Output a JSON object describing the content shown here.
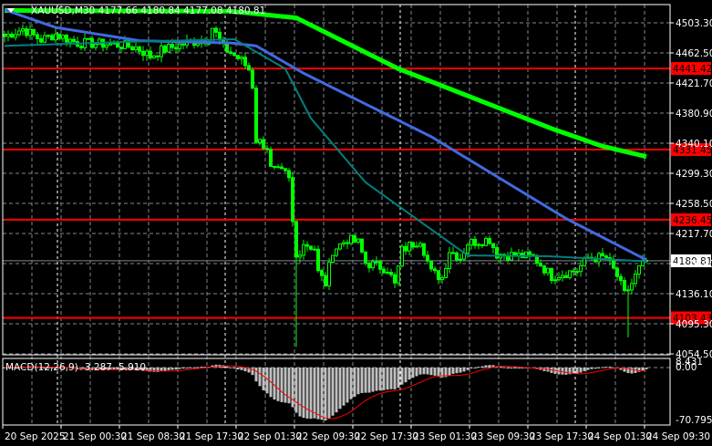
{
  "header": {
    "text": "XAUUSD,M30  4177.66 4180.84 4177.08 4180.81"
  },
  "price_axis": {
    "labels": [
      "4503.30",
      "4462.50",
      "4421.70",
      "4380.90",
      "4340.10",
      "4299.30",
      "4258.50",
      "4217.70",
      "4176.90",
      "4136.10",
      "4095.30",
      "4054.50"
    ]
  },
  "levels": [
    {
      "label": "4441.42",
      "price": 4441.42
    },
    {
      "label": "4331.45",
      "price": 4331.45
    },
    {
      "label": "4236.45",
      "price": 4236.45
    },
    {
      "label": "4103.43",
      "price": 4103.43
    }
  ],
  "current_price": {
    "label": "4180.81",
    "price": 4180.81
  },
  "time_axis": {
    "labels": [
      "20 Sep 2025",
      "21 Sep 00:30",
      "21 Sep 08:30",
      "21 Sep 17:30",
      "22 Sep 01:30",
      "22 Sep 09:30",
      "22 Sep 17:30",
      "23 Sep 01:30",
      "23 Sep 09:30",
      "23 Sep 17:30",
      "24 Sep 01:30",
      "24 Sep 09:30"
    ]
  },
  "macd": {
    "label": "MACD(12,26,9) -3.287 -5.910",
    "axis_labels": [
      "8.431",
      "0.00",
      "-70.795"
    ],
    "max": 8.431,
    "min": -70.795
  },
  "colors": {
    "candle": "#00ff00",
    "ma_slow": "#00ff00",
    "ma_mid": "#4169e1",
    "ma_fast": "#008080",
    "level": "#ff0000",
    "macd_hist": "#c0c0c0",
    "macd_signal": "#ff0000"
  },
  "chart_data": {
    "type": "candlestick",
    "symbol": "XAUUSD",
    "timeframe": "M30",
    "bars": 177,
    "ylim": [
      4054.5,
      4520
    ],
    "close_keypoints": [
      [
        0,
        4485
      ],
      [
        5,
        4495
      ],
      [
        10,
        4480
      ],
      [
        14,
        4488
      ],
      [
        20,
        4476
      ],
      [
        30,
        4474
      ],
      [
        36,
        4470
      ],
      [
        40,
        4458
      ],
      [
        43,
        4466
      ],
      [
        50,
        4476
      ],
      [
        56,
        4482
      ],
      [
        57,
        4497
      ],
      [
        60,
        4470
      ],
      [
        65,
        4452
      ],
      [
        67,
        4440
      ],
      [
        68,
        4418
      ],
      [
        69,
        4345
      ],
      [
        72,
        4335
      ],
      [
        73,
        4305
      ],
      [
        77,
        4298
      ],
      [
        78,
        4290
      ],
      [
        79,
        4232
      ],
      [
        80,
        4185
      ],
      [
        82,
        4205
      ],
      [
        85,
        4198
      ],
      [
        86,
        4165
      ],
      [
        88,
        4150
      ],
      [
        90,
        4195
      ],
      [
        94,
        4210
      ],
      [
        97,
        4205
      ],
      [
        99,
        4178
      ],
      [
        105,
        4170
      ],
      [
        107,
        4148
      ],
      [
        109,
        4195
      ],
      [
        114,
        4210
      ],
      [
        117,
        4165
      ],
      [
        120,
        4158
      ],
      [
        122,
        4195
      ],
      [
        125,
        4185
      ],
      [
        127,
        4205
      ],
      [
        133,
        4210
      ],
      [
        135,
        4190
      ],
      [
        145,
        4186
      ],
      [
        150,
        4160
      ],
      [
        157,
        4168
      ],
      [
        160,
        4185
      ],
      [
        165,
        4185
      ],
      [
        168,
        4160
      ],
      [
        170,
        4135
      ],
      [
        172,
        4150
      ],
      [
        174,
        4170
      ],
      [
        176,
        4181
      ]
    ],
    "wick_lows": [
      [
        80,
        4064
      ],
      [
        171,
        4077
      ]
    ],
    "ma_slow": [
      [
        0,
        4520
      ],
      [
        62,
        4519
      ],
      [
        80,
        4510
      ],
      [
        108,
        4441
      ],
      [
        150,
        4360
      ],
      [
        164,
        4336
      ],
      [
        176,
        4322
      ]
    ],
    "ma_mid": [
      [
        0,
        4521
      ],
      [
        14,
        4497
      ],
      [
        37,
        4479
      ],
      [
        62,
        4476
      ],
      [
        69,
        4472
      ],
      [
        82,
        4435
      ],
      [
        117,
        4349
      ],
      [
        154,
        4238
      ],
      [
        176,
        4182
      ]
    ],
    "ma_fast": [
      [
        0,
        4472
      ],
      [
        37,
        4478
      ],
      [
        63,
        4481
      ],
      [
        77,
        4441
      ],
      [
        84,
        4374
      ],
      [
        99,
        4287
      ],
      [
        127,
        4188
      ],
      [
        149,
        4187
      ],
      [
        176,
        4180
      ]
    ]
  }
}
